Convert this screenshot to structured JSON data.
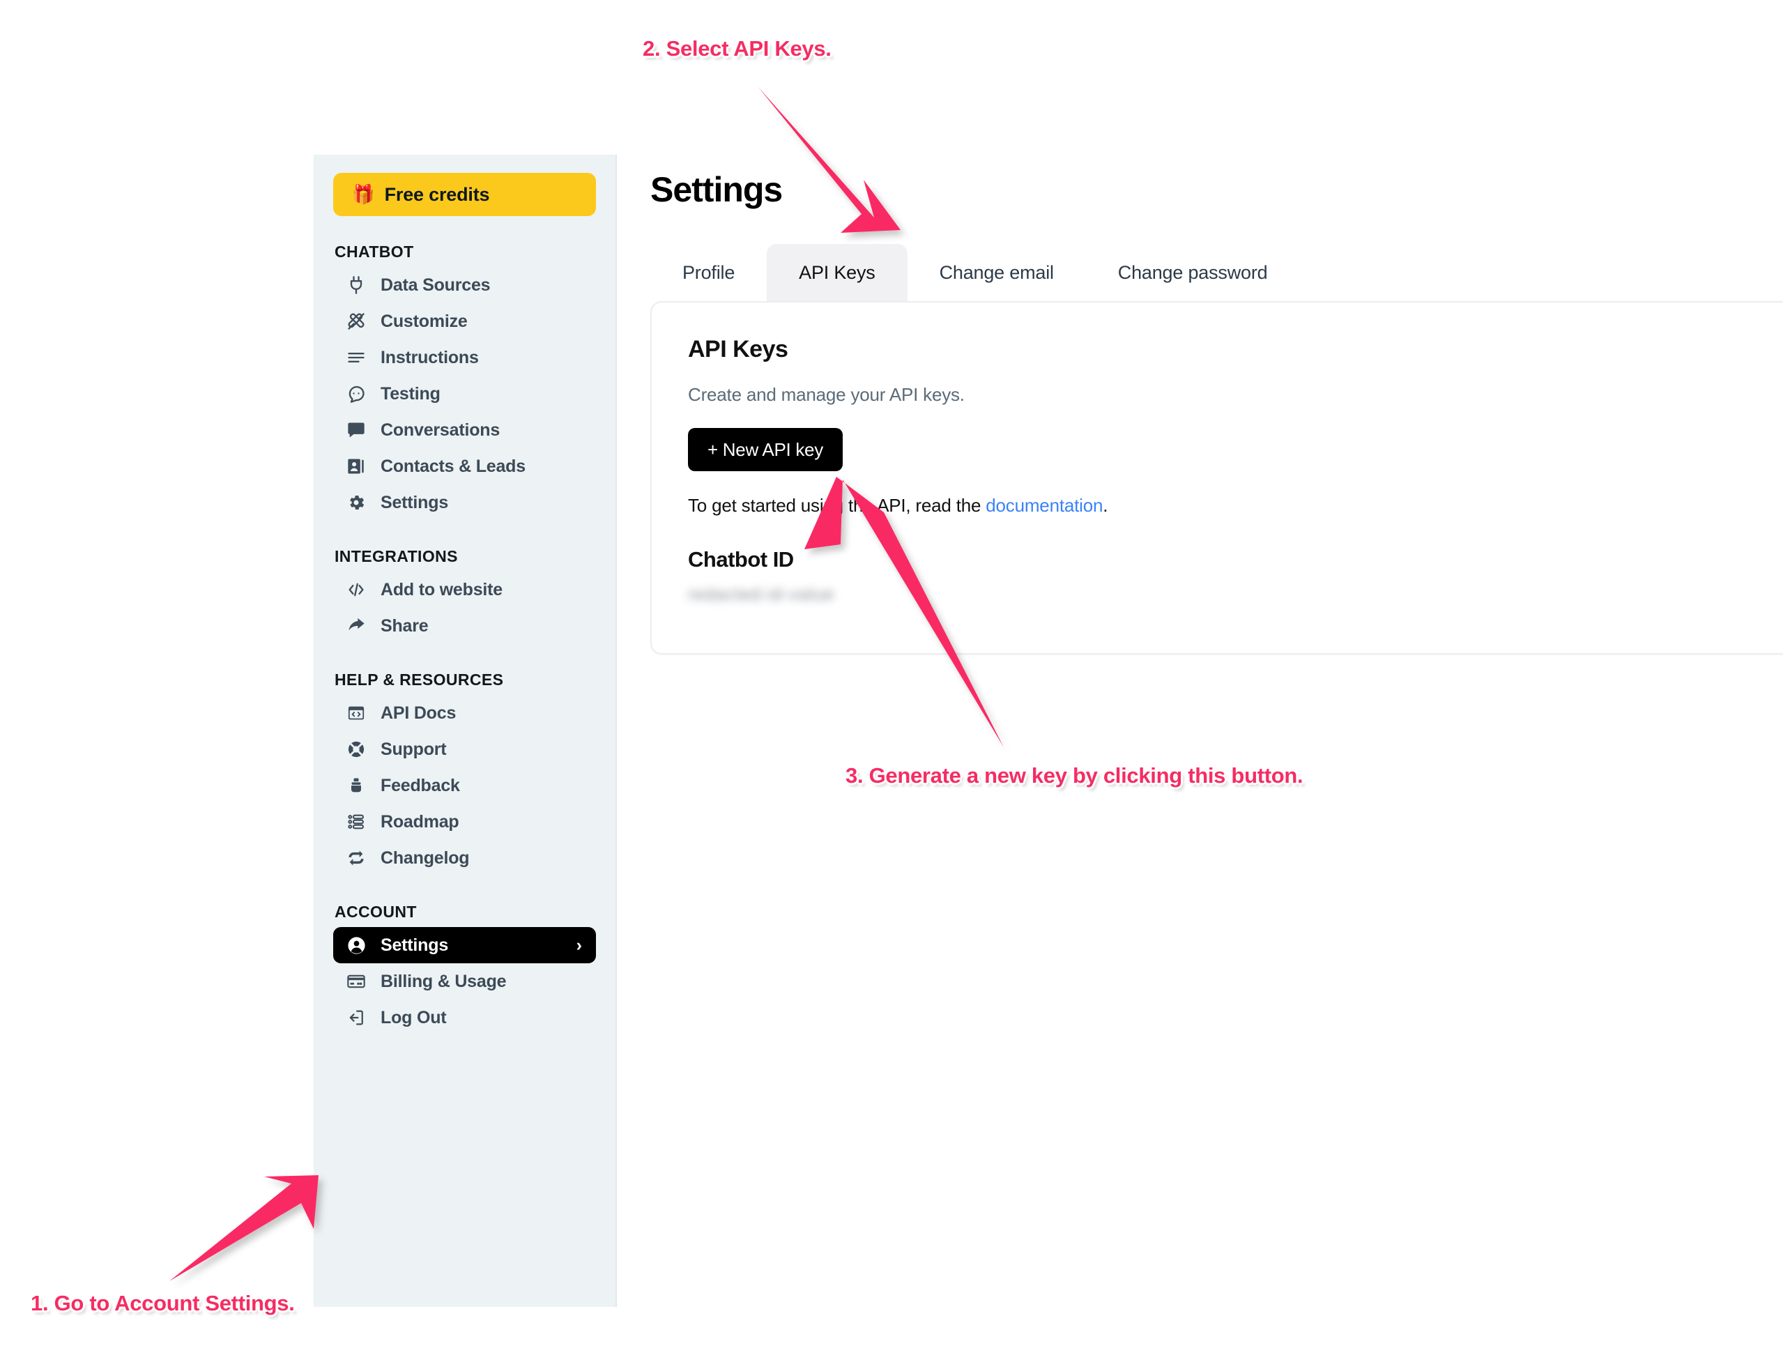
{
  "sidebar": {
    "free_credits": {
      "label": "Free credits",
      "icon": "gift-icon",
      "emoji": "🎁",
      "bg": "#FBC91B"
    },
    "sections": [
      {
        "title": "CHATBOT",
        "items": [
          {
            "label": "Data Sources",
            "icon": "plug-icon"
          },
          {
            "label": "Customize",
            "icon": "brush-icon"
          },
          {
            "label": "Instructions",
            "icon": "lines-icon"
          },
          {
            "label": "Testing",
            "icon": "chat-bubble-dots-icon"
          },
          {
            "label": "Conversations",
            "icon": "chat-bubble-filled-icon"
          },
          {
            "label": "Contacts & Leads",
            "icon": "contact-card-icon"
          },
          {
            "label": "Settings",
            "icon": "gear-icon"
          }
        ]
      },
      {
        "title": "INTEGRATIONS",
        "items": [
          {
            "label": "Add to website",
            "icon": "code-brackets-icon"
          },
          {
            "label": "Share",
            "icon": "share-arrow-icon"
          }
        ]
      },
      {
        "title": "HELP & RESOURCES",
        "items": [
          {
            "label": "API Docs",
            "icon": "browser-code-icon"
          },
          {
            "label": "Support",
            "icon": "lifebuoy-icon"
          },
          {
            "label": "Feedback",
            "icon": "inkwell-icon"
          },
          {
            "label": "Roadmap",
            "icon": "roadmap-list-icon"
          },
          {
            "label": "Changelog",
            "icon": "refresh-cycle-icon"
          }
        ]
      },
      {
        "title": "ACCOUNT",
        "items": [
          {
            "label": "Settings",
            "icon": "user-circle-icon",
            "active": true,
            "chevron": "›"
          },
          {
            "label": "Billing & Usage",
            "icon": "credit-card-icon"
          },
          {
            "label": "Log Out",
            "icon": "logout-icon"
          }
        ]
      }
    ]
  },
  "main": {
    "page_title": "Settings",
    "tabs": [
      {
        "label": "Profile",
        "active": false
      },
      {
        "label": "API Keys",
        "active": true
      },
      {
        "label": "Change email",
        "active": false
      },
      {
        "label": "Change password",
        "active": false
      }
    ],
    "card": {
      "title": "API Keys",
      "subtitle": "Create and manage your API keys.",
      "new_key_button": "+ New API key",
      "doc_text_before": "To get started using the API, read the ",
      "doc_link": "documentation",
      "doc_text_after": ".",
      "chatbot_id_label": "Chatbot ID",
      "chatbot_id_value": "redacted-id-value"
    }
  },
  "annotations": [
    {
      "id": "ann-1",
      "text": "1. Go to Account Settings."
    },
    {
      "id": "ann-2",
      "text": "2. Select API Keys."
    },
    {
      "id": "ann-3",
      "text": "3. Generate a new key by clicking this button."
    }
  ],
  "colors": {
    "annotation_pink": "#F52C63",
    "arrow_pink": "#F92A63",
    "sidebar_bg": "#EDF2F4",
    "free_credits_bg": "#FBC91B",
    "active_nav_bg": "#000000",
    "link_blue": "#3B82F6",
    "active_tab_bg": "#F1F1F3"
  }
}
